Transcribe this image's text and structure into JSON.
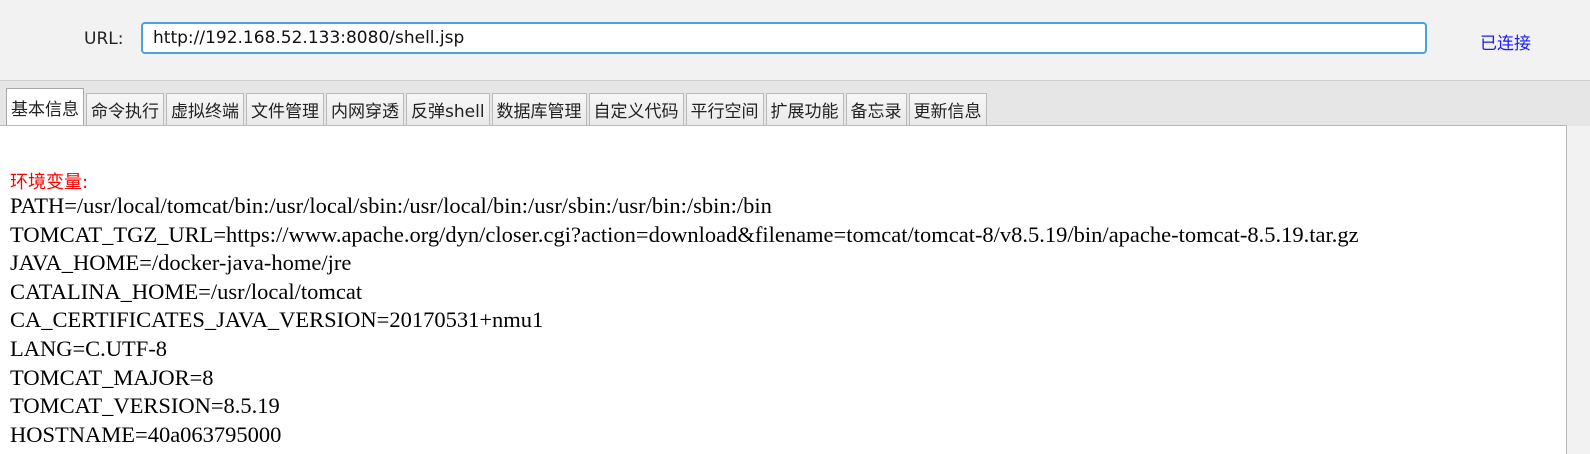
{
  "url_bar": {
    "label": "URL:",
    "value": "http://192.168.52.133:8080/shell.jsp",
    "status": "已连接"
  },
  "tabs": [
    {
      "label": "基本信息",
      "active": true
    },
    {
      "label": "命令执行"
    },
    {
      "label": "虚拟终端"
    },
    {
      "label": "文件管理"
    },
    {
      "label": "内网穿透"
    },
    {
      "label": "反弹shell"
    },
    {
      "label": "数据库管理"
    },
    {
      "label": "自定义代码"
    },
    {
      "label": "平行空间"
    },
    {
      "label": "扩展功能"
    },
    {
      "label": "备忘录"
    },
    {
      "label": "更新信息"
    }
  ],
  "content": {
    "section_title": "环境变量:",
    "env_lines": [
      "PATH=/usr/local/tomcat/bin:/usr/local/sbin:/usr/local/bin:/usr/sbin:/usr/bin:/sbin:/bin",
      "TOMCAT_TGZ_URL=https://www.apache.org/dyn/closer.cgi?action=download&filename=tomcat/tomcat-8/v8.5.19/bin/apache-tomcat-8.5.19.tar.gz",
      "JAVA_HOME=/docker-java-home/jre",
      "CATALINA_HOME=/usr/local/tomcat",
      "CA_CERTIFICATES_JAVA_VERSION=20170531+nmu1",
      "LANG=C.UTF-8",
      "TOMCAT_MAJOR=8",
      "TOMCAT_VERSION=8.5.19",
      "HOSTNAME=40a063795000"
    ]
  },
  "colors": {
    "status": "#1a1aff",
    "section_title": "#ff0000",
    "url_input_border": "#4aa3e0"
  }
}
